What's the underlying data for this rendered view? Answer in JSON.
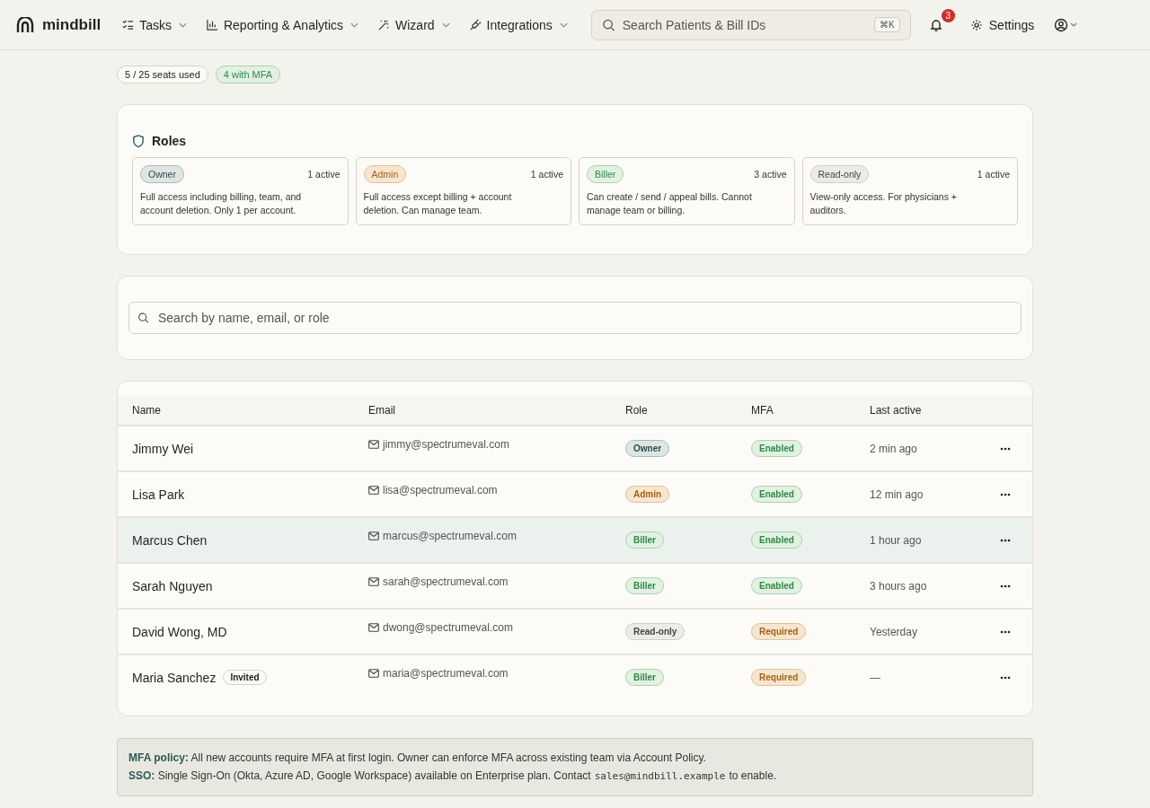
{
  "nav": {
    "brand": "mindbill",
    "menus": [
      {
        "label": "Tasks"
      },
      {
        "label": "Reporting & Analytics"
      },
      {
        "label": "Wizard"
      },
      {
        "label": "Integrations"
      }
    ],
    "search": {
      "placeholder": "Search Patients & Bill IDs",
      "shortcut": "⌘K"
    },
    "notifications": "3",
    "settings": "Settings"
  },
  "header": {
    "badges": [
      {
        "label": "5 / 25 seats used",
        "kind": "neutral"
      },
      {
        "label": "4 with MFA",
        "kind": "success"
      }
    ]
  },
  "roles": {
    "title": "Roles",
    "items": [
      {
        "name": "Owner",
        "kind": "owner",
        "count": "1 active",
        "description": "Full access including billing, team, and account deletion. Only 1 per account."
      },
      {
        "name": "Admin",
        "kind": "admin",
        "count": "1 active",
        "description": "Full access except billing + account deletion. Can manage team."
      },
      {
        "name": "Biller",
        "kind": "biller",
        "count": "3 active",
        "description": "Can create / send / appeal bills. Cannot manage team or billing."
      },
      {
        "name": "Read-only",
        "kind": "readonly",
        "count": "1 active",
        "description": "View-only access. For physicians + auditors."
      }
    ]
  },
  "search": {
    "placeholder": "Search by name, email, or role"
  },
  "table": {
    "columns": [
      "Name",
      "Email",
      "Role",
      "MFA",
      "Last active"
    ],
    "rows": [
      {
        "name": "Jimmy Wei",
        "email": "jimmy@spectrumeval.com",
        "role": {
          "label": "Owner",
          "kind": "owner"
        },
        "mfa": {
          "label": "Enabled",
          "kind": "enabled"
        },
        "last_active": "2 min ago",
        "selected": false
      },
      {
        "name": "Lisa Park",
        "email": "lisa@spectrumeval.com",
        "role": {
          "label": "Admin",
          "kind": "admin"
        },
        "mfa": {
          "label": "Enabled",
          "kind": "enabled"
        },
        "last_active": "12 min ago",
        "selected": false
      },
      {
        "name": "Marcus Chen",
        "email": "marcus@spectrumeval.com",
        "role": {
          "label": "Biller",
          "kind": "biller"
        },
        "mfa": {
          "label": "Enabled",
          "kind": "enabled"
        },
        "last_active": "1 hour ago",
        "selected": true
      },
      {
        "name": "Sarah Nguyen",
        "email": "sarah@spectrumeval.com",
        "role": {
          "label": "Biller",
          "kind": "biller"
        },
        "mfa": {
          "label": "Enabled",
          "kind": "enabled"
        },
        "last_active": "3 hours ago",
        "selected": false
      },
      {
        "name": "David Wong, MD",
        "email": "dwong@spectrumeval.com",
        "role": {
          "label": "Read-only",
          "kind": "readonly"
        },
        "mfa": {
          "label": "Required",
          "kind": "required"
        },
        "last_active": "Yesterday",
        "selected": false
      },
      {
        "name": "Maria Sanchez",
        "tag": "Invited",
        "email": "maria@spectrumeval.com",
        "role": {
          "label": "Biller",
          "kind": "biller"
        },
        "mfa": {
          "label": "Required",
          "kind": "required"
        },
        "last_active": "—",
        "selected": false
      }
    ]
  },
  "notes": [
    {
      "label": "MFA policy:",
      "text": "All new accounts require MFA at first login. Owner can enforce MFA across existing team via Account Policy."
    },
    {
      "label": "SSO:",
      "text": "Single Sign-On (Okta, Azure AD, Google Workspace) available on Enterprise plan. Contact",
      "code": "sales@mindbill.example",
      "after": "to enable."
    }
  ]
}
